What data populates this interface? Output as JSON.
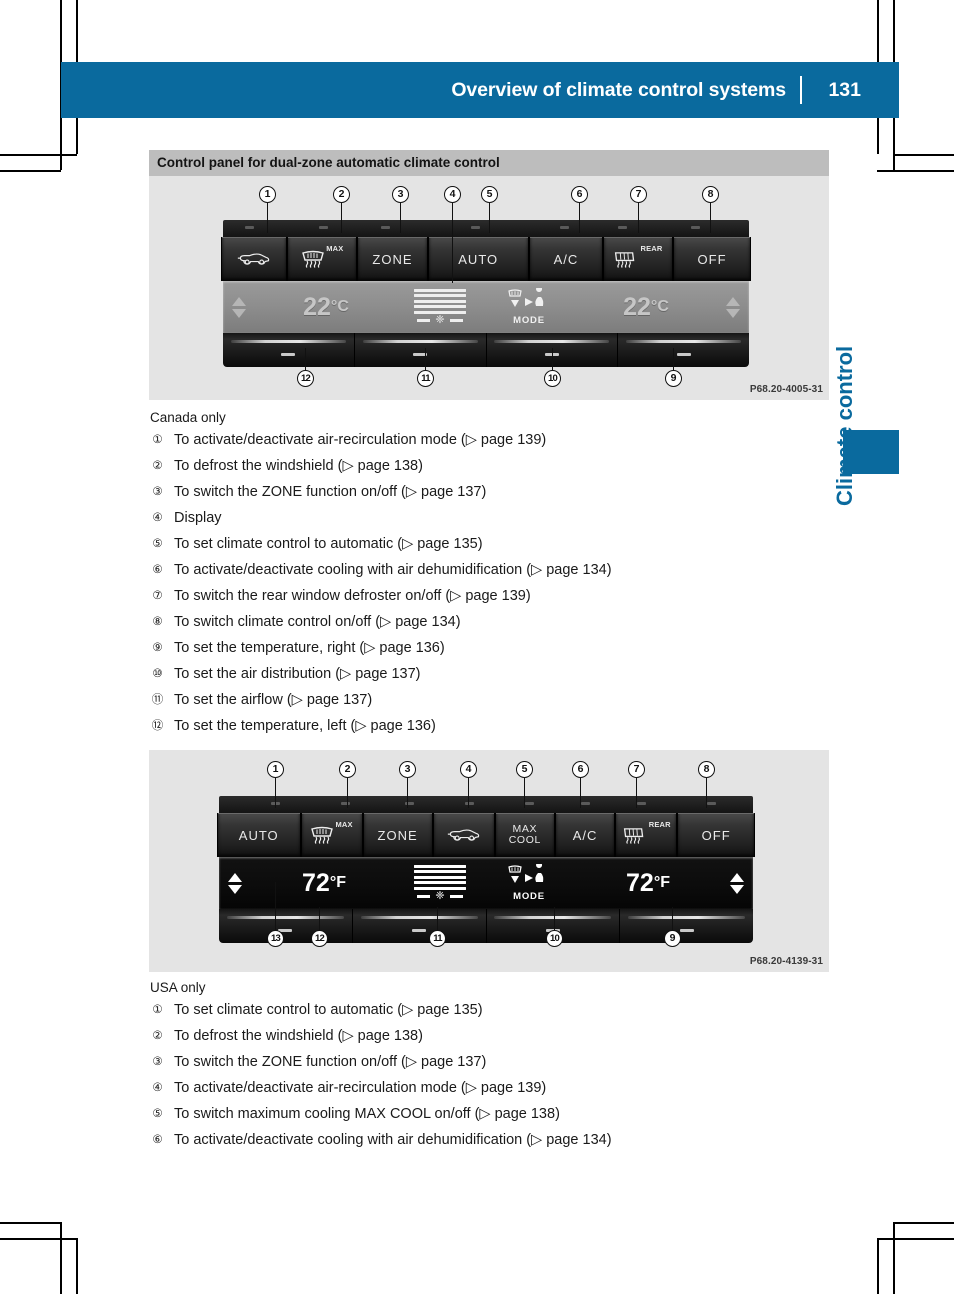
{
  "header": {
    "title": "Overview of climate control systems",
    "page_number": "131",
    "accent_color": "#0a6a9e"
  },
  "side_tab": {
    "label": "Climate control",
    "color": "#0a6a9e"
  },
  "section": {
    "heading": "Control panel for dual-zone automatic climate control"
  },
  "figure_canada": {
    "code": "P68.20-4005-31",
    "buttons": [
      {
        "label": "",
        "icon": "air-recirculation-icon"
      },
      {
        "label": "MAX",
        "icon": "windshield-defrost-icon"
      },
      {
        "label": "ZONE",
        "icon": ""
      },
      {
        "label": "AUTO",
        "icon": ""
      },
      {
        "label": "A/C",
        "icon": ""
      },
      {
        "label": "REAR",
        "icon": "rear-window-defroster-icon"
      },
      {
        "label": "OFF",
        "icon": ""
      }
    ],
    "display": {
      "temp_left": "22",
      "temp_left_unit": "°C",
      "temp_right": "22",
      "temp_right_unit": "°C",
      "mode_label": "MODE",
      "fan_icon": "fan-icon"
    },
    "callouts_top": [
      "1",
      "2",
      "3",
      "4",
      "5",
      "6",
      "7",
      "8"
    ],
    "callouts_bottom": [
      "12",
      "11",
      "10",
      "9"
    ]
  },
  "list_canada": {
    "note": "Canada only",
    "items": [
      {
        "num": "1",
        "text": "To activate/deactivate air-recirculation mode (▷ page 139)"
      },
      {
        "num": "2",
        "text": "To defrost the windshield (▷ page 138)"
      },
      {
        "num": "3",
        "text": "To switch the ZONE function on/off (▷ page 137)"
      },
      {
        "num": "4",
        "text": "Display"
      },
      {
        "num": "5",
        "text": "To set climate control to automatic (▷ page 135)"
      },
      {
        "num": "6",
        "text": "To activate/deactivate cooling with air dehumidification (▷ page 134)"
      },
      {
        "num": "7",
        "text": "To switch the rear window defroster on/off (▷ page 139)"
      },
      {
        "num": "8",
        "text": "To switch climate control on/off (▷ page 134)"
      },
      {
        "num": "9",
        "text": "To set the temperature, right (▷ page 136)"
      },
      {
        "num": "10",
        "text": "To set the air distribution (▷ page 137)"
      },
      {
        "num": "11",
        "text": "To set the airflow (▷ page 137)"
      },
      {
        "num": "12",
        "text": "To set the temperature, left (▷ page 136)"
      }
    ]
  },
  "figure_usa": {
    "code": "P68.20-4139-31",
    "buttons": [
      {
        "label": "AUTO",
        "icon": ""
      },
      {
        "label": "MAX",
        "icon": "windshield-defrost-icon"
      },
      {
        "label": "ZONE",
        "icon": ""
      },
      {
        "label": "",
        "icon": "air-recirculation-icon"
      },
      {
        "label": "MAX COOL",
        "icon": ""
      },
      {
        "label": "A/C",
        "icon": ""
      },
      {
        "label": "REAR",
        "icon": "rear-window-defroster-icon"
      },
      {
        "label": "OFF",
        "icon": ""
      }
    ],
    "display": {
      "temp_left": "72",
      "temp_left_unit": "°F",
      "temp_right": "72",
      "temp_right_unit": "°F",
      "mode_label": "MODE",
      "fan_icon": "fan-icon"
    },
    "callouts_top": [
      "1",
      "2",
      "3",
      "4",
      "5",
      "6",
      "7",
      "8"
    ],
    "callouts_bottom": [
      "13",
      "12",
      "11",
      "10",
      "9"
    ]
  },
  "list_usa": {
    "note": "USA only",
    "items": [
      {
        "num": "1",
        "text": "To set climate control to automatic (▷ page 135)"
      },
      {
        "num": "2",
        "text": "To defrost the windshield (▷ page 138)"
      },
      {
        "num": "3",
        "text": "To switch the ZONE function on/off (▷ page 137)"
      },
      {
        "num": "4",
        "text": "To activate/deactivate air-recirculation mode (▷ page 139)"
      },
      {
        "num": "5",
        "text": "To switch maximum cooling MAX COOL on/off (▷ page 138)"
      },
      {
        "num": "6",
        "text": "To activate/deactivate cooling with air dehumidification (▷ page 134)"
      }
    ]
  }
}
